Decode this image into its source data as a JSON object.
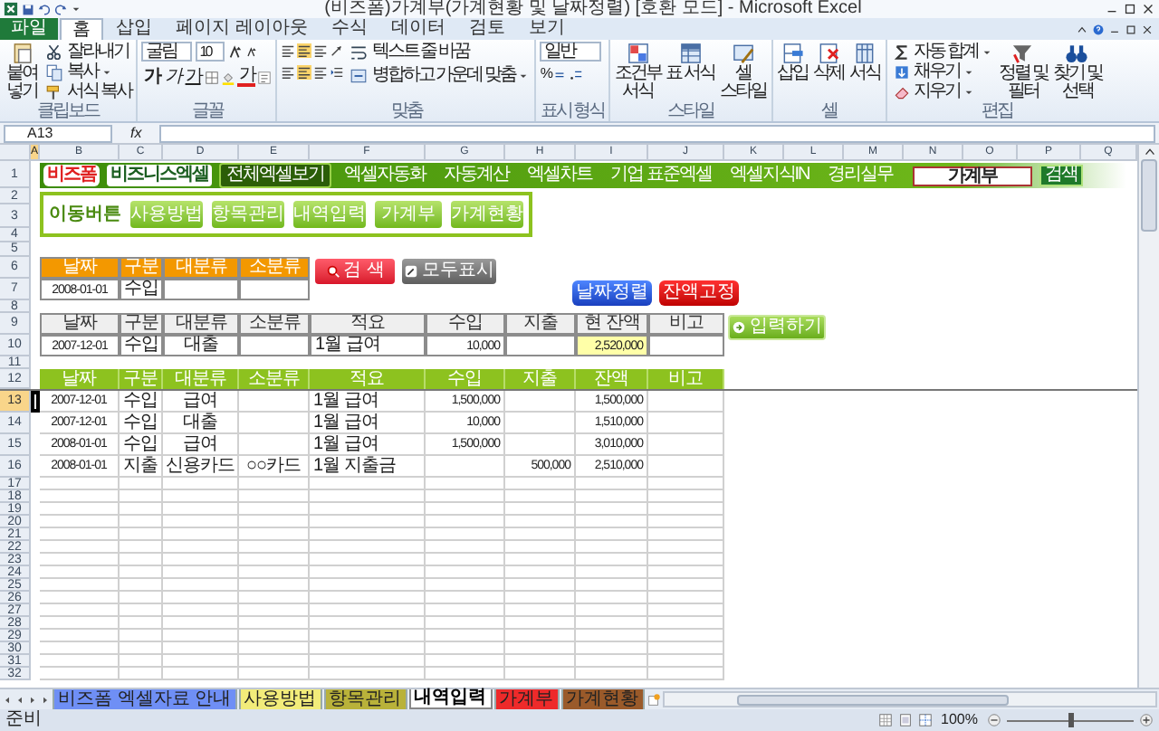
{
  "title_bar": {
    "title": "(비즈폼)가계부(가계현황 및 날짜정렬) [호환 모드] - Microsoft Excel"
  },
  "ribbon_tabs": [
    {
      "label": "파일",
      "kind": "file",
      "selected": false
    },
    {
      "label": "홈",
      "kind": "tab",
      "selected": true
    },
    {
      "label": "삽입",
      "kind": "tab",
      "selected": false
    },
    {
      "label": "페이지 레이아웃",
      "kind": "tab",
      "selected": false
    },
    {
      "label": "수식",
      "kind": "tab",
      "selected": false
    },
    {
      "label": "데이터",
      "kind": "tab",
      "selected": false
    },
    {
      "label": "검토",
      "kind": "tab",
      "selected": false
    },
    {
      "label": "보기",
      "kind": "tab",
      "selected": false
    }
  ],
  "ribbon": {
    "clipboard": {
      "label": "클립보드",
      "paste": "붙여넣기",
      "cut": "잘라내기",
      "copy": "복사",
      "format_painter": "서식 복사"
    },
    "font": {
      "label": "글꼴",
      "name": "굴림",
      "size": "10",
      "bold": "가",
      "italic": "가",
      "underline": "가",
      "font_color": "가"
    },
    "alignment": {
      "label": "맞춤",
      "wrap": "텍스트 줄 바꿈",
      "merge": "병합하고 가운데 맞춤"
    },
    "number": {
      "label": "표시 형식",
      "format": "일반",
      "percent": "%"
    },
    "styles": {
      "label": "스타일",
      "items": [
        "조건부 서식",
        "표 서식",
        "셀 스타일"
      ]
    },
    "cells": {
      "label": "셀",
      "items": [
        "삽입",
        "삭제",
        "서식"
      ]
    },
    "editing": {
      "label": "편집",
      "autosum": "자동 합계",
      "fill": "채우기",
      "clear": "지우기",
      "items": [
        "정렬 및 필터",
        "찾기 및 선택"
      ]
    }
  },
  "formula_bar": {
    "name_box": "A13",
    "fx": "fx"
  },
  "column_headers": [
    {
      "label": "A",
      "selected": true
    },
    {
      "label": "B",
      "selected": false
    },
    {
      "label": "C",
      "selected": false
    },
    {
      "label": "D",
      "selected": false
    },
    {
      "label": "E",
      "selected": false
    },
    {
      "label": "F",
      "selected": false
    },
    {
      "label": "G",
      "selected": false
    },
    {
      "label": "H",
      "selected": false
    },
    {
      "label": "I",
      "selected": false
    },
    {
      "label": "J",
      "selected": false
    },
    {
      "label": "K",
      "selected": false
    },
    {
      "label": "L",
      "selected": false
    },
    {
      "label": "M",
      "selected": false
    },
    {
      "label": "N",
      "selected": false
    },
    {
      "label": "O",
      "selected": false
    },
    {
      "label": "P",
      "selected": false
    },
    {
      "label": "Q",
      "selected": false
    }
  ],
  "row_numbers": [
    {
      "label": "1",
      "selected": false
    },
    {
      "label": "2",
      "selected": false
    },
    {
      "label": "3",
      "selected": false
    },
    {
      "label": "4",
      "selected": false
    },
    {
      "label": "5",
      "selected": false
    },
    {
      "label": "6",
      "selected": false
    },
    {
      "label": "7",
      "selected": false
    },
    {
      "label": "8",
      "selected": false
    },
    {
      "label": "9",
      "selected": false
    },
    {
      "label": "10",
      "selected": false
    },
    {
      "label": "11",
      "selected": false
    },
    {
      "label": "12",
      "selected": false
    },
    {
      "label": "13",
      "selected": true
    },
    {
      "label": "14",
      "selected": false
    },
    {
      "label": "15",
      "selected": false
    },
    {
      "label": "16",
      "selected": false
    },
    {
      "label": "17",
      "selected": false
    },
    {
      "label": "18",
      "selected": false
    },
    {
      "label": "19",
      "selected": false
    },
    {
      "label": "20",
      "selected": false
    },
    {
      "label": "21",
      "selected": false
    },
    {
      "label": "22",
      "selected": false
    },
    {
      "label": "23",
      "selected": false
    },
    {
      "label": "24",
      "selected": false
    },
    {
      "label": "25",
      "selected": false
    },
    {
      "label": "26",
      "selected": false
    },
    {
      "label": "27",
      "selected": false
    },
    {
      "label": "28",
      "selected": false
    },
    {
      "label": "29",
      "selected": false
    },
    {
      "label": "30",
      "selected": false
    },
    {
      "label": "31",
      "selected": false
    },
    {
      "label": "32",
      "selected": false
    }
  ],
  "banner": {
    "logo": "비즈폼",
    "logo_sub": "비즈니스엑셀",
    "menu": [
      {
        "label": "전체엑셀보기",
        "selected": true
      },
      {
        "label": "엑셀자동화",
        "selected": false
      },
      {
        "label": "자동계산",
        "selected": false
      },
      {
        "label": "엑셀차트",
        "selected": false
      },
      {
        "label": "기업 표준엑셀",
        "selected": false
      },
      {
        "label": "엑셀지식IN",
        "selected": false
      },
      {
        "label": "경리실무",
        "selected": false
      }
    ],
    "search_value": "가계부",
    "search_button": "검색"
  },
  "nav_panel": {
    "label": "이동버튼",
    "buttons": [
      "사용방법",
      "항목관리",
      "내역입력",
      "가계부",
      "가계현황"
    ]
  },
  "search_panel": {
    "headers": [
      "날짜",
      "구분",
      "대분류",
      "소분류"
    ],
    "values": {
      "date": "2008-01-01",
      "type": "수입"
    }
  },
  "search_button": "검 색",
  "show_all_button": "모두표시",
  "sort_button": "날짜정렬",
  "fix_balance_button": "잔액고정",
  "input_button": "입력하기",
  "entry": {
    "headers": [
      "날짜",
      "구분",
      "대분류",
      "소분류",
      "적요",
      "수입",
      "지출",
      "현 잔액",
      "비고"
    ],
    "values": {
      "date": "2007-12-01",
      "type": "수입",
      "category": "대출",
      "memo": "1월 급여",
      "income": "10,000",
      "balance": "2,520,000"
    }
  },
  "ledger": {
    "columns": [
      "날짜",
      "구분",
      "대분류",
      "소분류",
      "적요",
      "수입",
      "지출",
      "잔액",
      "비고"
    ],
    "rows": [
      {
        "date": "2007-12-01",
        "type": "수입",
        "category": "급여",
        "memo": "1월 급여",
        "income": "1,500,000",
        "balance": "1,500,000"
      },
      {
        "date": "2007-12-01",
        "type": "수입",
        "category": "대출",
        "memo": "1월 급여",
        "income": "10,000",
        "balance": "1,510,000"
      },
      {
        "date": "2008-01-01",
        "type": "수입",
        "category": "급여",
        "memo": "1월 급여",
        "income": "1,500,000",
        "balance": "3,010,000"
      },
      {
        "date": "2008-01-01",
        "type": "지출",
        "category": "신용카드",
        "subcategory": "○○카드",
        "memo": "1월 지출금",
        "expense": "500,000",
        "balance": "2,510,000"
      }
    ]
  },
  "sheet_tabs": [
    {
      "label": "비즈폼 엑셀자료 안내",
      "color": "#6f8ff5",
      "selected": false
    },
    {
      "label": "사용방법",
      "color": "#f2ec7a",
      "selected": false
    },
    {
      "label": "항목관리",
      "color": "#b9b23a",
      "selected": false
    },
    {
      "label": "내역입력",
      "color": "#ffffff",
      "selected": true
    },
    {
      "label": "가계부",
      "color": "#ee2a2a",
      "selected": false
    },
    {
      "label": "가계현황",
      "color": "#9a5a2a",
      "selected": false
    }
  ],
  "status_bar": {
    "status": "준비",
    "zoom": "100%",
    "zoom_slider": {
      "level": 0.5
    }
  }
}
